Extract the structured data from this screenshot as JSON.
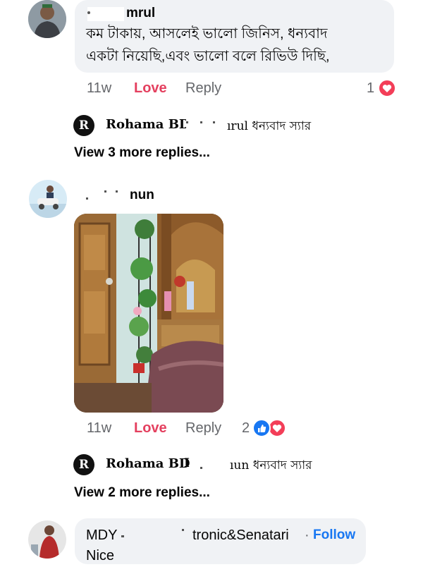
{
  "comment1": {
    "author": "mrul",
    "text_line1": "কম টাকায়, আসলেই ভালো জিনিস, ধন্যবাদ",
    "text_line2": "একটা নিয়েছি,এবং ভালো বলে রিভিউ দিছি,",
    "time": "11w",
    "love": "Love",
    "reply": "Reply",
    "reaction_count": "1"
  },
  "reply1": {
    "logo": "R",
    "name": "Rohama BD",
    "text": "ırul ধন্যবাদ স্যার"
  },
  "view_more1": "View 3 more replies...",
  "comment2": {
    "author": "nun",
    "time": "11w",
    "love": "Love",
    "reply": "Reply",
    "reaction_count": "2"
  },
  "reply2": {
    "logo": "R",
    "name": "Rohama BD",
    "name_suffix": "I",
    "text": "ıun ধন্যবাদ স্যার"
  },
  "view_more2": "View 2 more replies...",
  "comment3": {
    "author_prefix": "MDY",
    "author_suffix": "tronic&Senatari",
    "separator": "·",
    "follow": "Follow",
    "text": "Nice"
  },
  "colors": {
    "love": "#e4405f",
    "like": "#1877f2",
    "heart": "#f33e58",
    "bubble": "#f0f2f5",
    "follow": "#1877f2"
  }
}
